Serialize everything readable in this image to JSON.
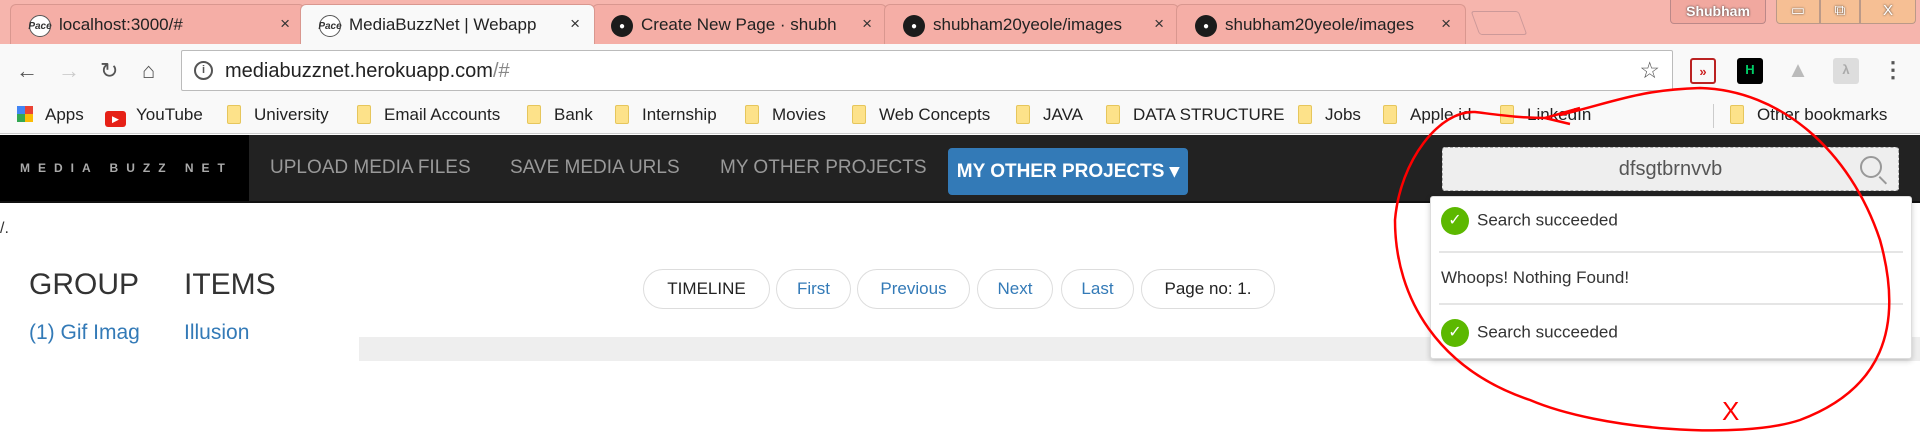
{
  "browser": {
    "tabs": [
      {
        "title": "localhost:3000/#",
        "icon": "pace-icon"
      },
      {
        "title": "MediaBuzzNet | Webapp",
        "icon": "pace-icon",
        "active": true
      },
      {
        "title": "Create New Page · shubham",
        "icon": "github-icon"
      },
      {
        "title": "shubham20yeole/images",
        "icon": "github-icon"
      },
      {
        "title": "shubham20yeole/images",
        "icon": "github-icon"
      }
    ],
    "favicon_text": "Pace",
    "close_glyph": "×",
    "user": "Shubham",
    "window_controls": {
      "minimize": "▭",
      "restore": "⧉",
      "close": "X"
    },
    "url_host": "mediabuzznet.herokuapp.com",
    "url_path": "/#",
    "bookmarks": [
      "Apps",
      "YouTube",
      "University",
      "Email Accounts",
      "Bank",
      "Internship",
      "Movies",
      "Web Concepts",
      "JAVA",
      "DATA STRUCTURE",
      "Jobs",
      "Apple id",
      "LinkedIn"
    ],
    "other_bookmarks": "Other bookmarks"
  },
  "navbar": {
    "logo": "MEDIA BUZZ NET",
    "items": [
      "UPLOAD MEDIA FILES",
      "SAVE MEDIA URLS",
      "MY OTHER PROJECTS"
    ],
    "dropdown": "MY OTHER PROJECTS ▾",
    "search_value": "dfsgtbrnvvb"
  },
  "content": {
    "path": "/.",
    "group_header": "GROUP",
    "items_header": "ITEMS",
    "group_link": "(1) Gif Imag",
    "item_link": "Illusion",
    "pager": {
      "timeline": "TIMELINE",
      "first": "First",
      "previous": "Previous",
      "next": "Next",
      "last": "Last",
      "page": "Page no: 1."
    }
  },
  "search_results": [
    "Search succeeded",
    "Whoops! Nothing Found!",
    "Search succeeded"
  ],
  "annotation": "X",
  "colors": {
    "tabbar": "#f6b5ad",
    "navbar": "#222222",
    "primary": "#337ab7",
    "success": "#5cb800",
    "annotation": "#ff0000"
  }
}
